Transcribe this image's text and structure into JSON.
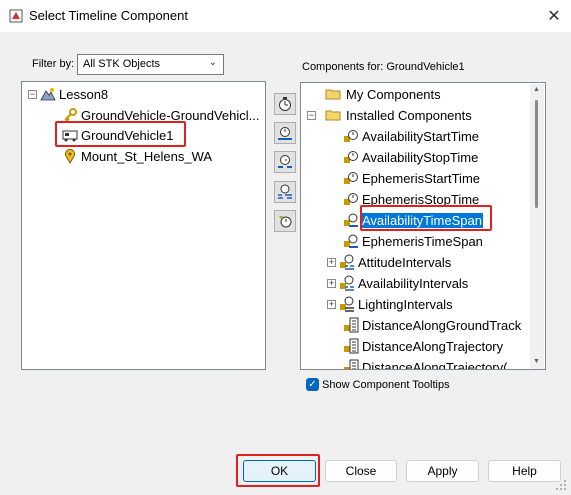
{
  "window": {
    "title": "Select Timeline Component",
    "close_glyph": "✕"
  },
  "filter": {
    "label": "Filter by:",
    "value": "All STK Objects"
  },
  "left_tree": {
    "items": [
      {
        "label": "Lesson8",
        "icon": "scenario-icon"
      },
      {
        "label": "GroundVehicle-GroundVehicl...",
        "icon": "access-key-icon"
      },
      {
        "label": "GroundVehicle1",
        "icon": "ground-vehicle-icon"
      },
      {
        "label": "Mount_St_Helens_WA",
        "icon": "place-pin-icon"
      }
    ]
  },
  "components_label": "Components for: GroundVehicle1",
  "right_tree": {
    "items": [
      {
        "label": "My Components",
        "icon": "folder-icon"
      },
      {
        "label": "Installed Components",
        "icon": "folder-icon"
      },
      {
        "label": "AvailabilityStartTime",
        "icon": "time-instant-icon"
      },
      {
        "label": "AvailabilityStopTime",
        "icon": "time-instant-icon"
      },
      {
        "label": "EphemerisStartTime",
        "icon": "time-instant-icon"
      },
      {
        "label": "EphemerisStopTime",
        "icon": "time-instant-icon"
      },
      {
        "label": "AvailabilityTimeSpan",
        "icon": "time-span-icon"
      },
      {
        "label": "EphemerisTimeSpan",
        "icon": "time-span-icon"
      },
      {
        "label": "AttitudeIntervals",
        "icon": "interval-list-icon"
      },
      {
        "label": "AvailabilityIntervals",
        "icon": "interval-list-icon"
      },
      {
        "label": "LightingIntervals",
        "icon": "lighting-icon"
      },
      {
        "label": "DistanceAlongGroundTrack",
        "icon": "calc-scalar-icon"
      },
      {
        "label": "DistanceAlongTrajectory",
        "icon": "calc-scalar-icon"
      },
      {
        "label": "DistanceAlongTrajectory(",
        "icon": "calc-scalar-icon"
      }
    ]
  },
  "tooltips_checkbox": {
    "label": "Show Component Tooltips",
    "checked": true
  },
  "buttons": {
    "ok": "OK",
    "close": "Close",
    "apply": "Apply",
    "help": "Help"
  },
  "colors": {
    "selection": "#0078d7",
    "highlight_box": "#e02020",
    "accent": "#0067c0"
  }
}
